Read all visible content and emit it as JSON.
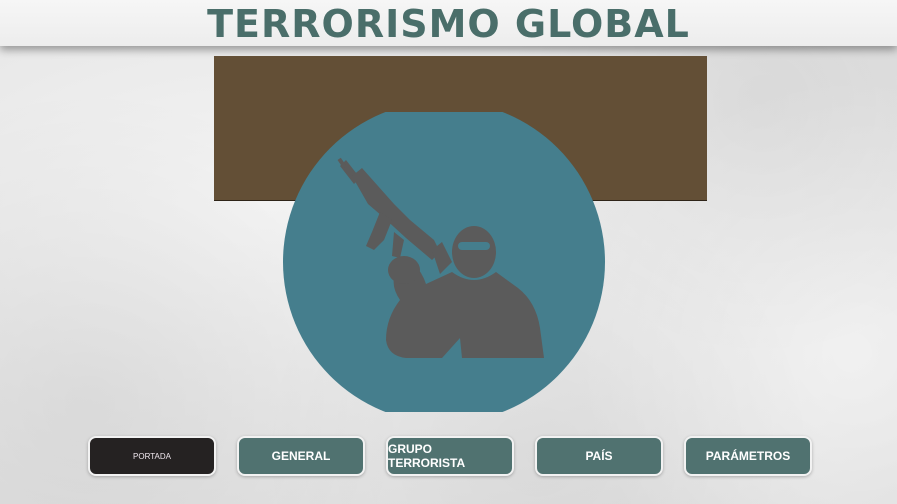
{
  "header": {
    "title": "TERRORISMO GLOBAL"
  },
  "colors": {
    "title": "#4a6e6a",
    "banner": "#634f36",
    "emblem_circle": "#457e8d",
    "silhouette": "#5b5b5b",
    "nav_button": "#507270",
    "nav_active": "#252222"
  },
  "emblem": {
    "icon": "armed-masked-figure-icon"
  },
  "nav": {
    "active": "PORTADA",
    "items": [
      {
        "label": "PORTADA"
      },
      {
        "label": "GENERAL"
      },
      {
        "label": "GRUPO TERRORISTA"
      },
      {
        "label": "PAÍS"
      },
      {
        "label": "PARÁMETROS"
      }
    ]
  }
}
